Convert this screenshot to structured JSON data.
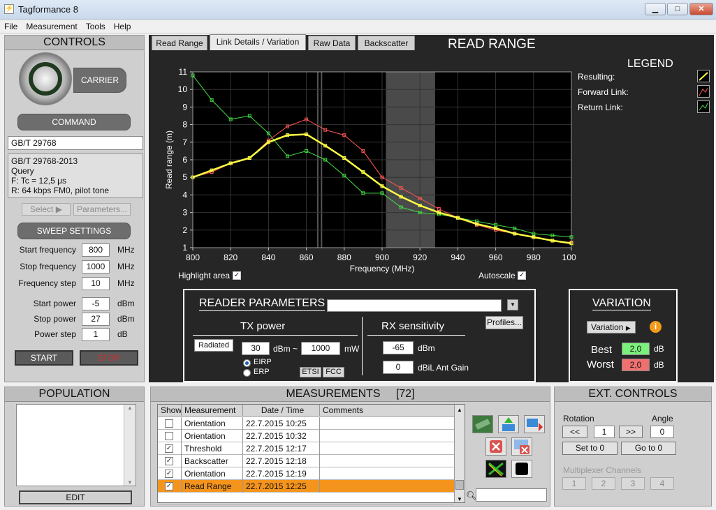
{
  "app": {
    "title": "Tagformance 8",
    "win_min": "▁",
    "win_max": "□",
    "win_close": "✕"
  },
  "menu": [
    "File",
    "Measurement",
    "Tools",
    "Help"
  ],
  "controls": {
    "title": "CONTROLS",
    "carrier": "CARRIER",
    "command": "COMMAND",
    "command_value": "GB/T 29768",
    "info": [
      "GB/T 29768-2013",
      "Query",
      "F: Tc = 12,5 μs",
      "R: 64 kbps FM0, pilot tone"
    ],
    "select": "Select",
    "parameters": "Parameters...",
    "sweep": "SWEEP SETTINGS",
    "rows": [
      {
        "label": "Start frequency",
        "value": "800",
        "unit": "MHz"
      },
      {
        "label": "Stop frequency",
        "value": "1000",
        "unit": "MHz"
      },
      {
        "label": "Frequency step",
        "value": "10",
        "unit": "MHz"
      },
      {
        "label": "Start power",
        "value": "-5",
        "unit": "dBm"
      },
      {
        "label": "Stop power",
        "value": "27",
        "unit": "dBm"
      },
      {
        "label": "Power step",
        "value": "1",
        "unit": "dB"
      }
    ],
    "start": "START",
    "stop": "STOP"
  },
  "tabs": [
    "Read Range",
    "Link Details / Variation",
    "Raw Data",
    "Backscatter"
  ],
  "view_title": "READ RANGE",
  "legend": {
    "title": "LEGEND",
    "items": [
      "Resulting:",
      "Forward Link:",
      "Return Link:"
    ],
    "colors": [
      "#ffff44",
      "#ff5555",
      "#44dd44"
    ]
  },
  "chart_data": {
    "type": "line",
    "xlabel": "Frequency (MHz)",
    "ylabel": "Read range (m)",
    "xlim": [
      800,
      1000
    ],
    "ylim": [
      1,
      11
    ],
    "xticks": [
      800,
      820,
      840,
      860,
      880,
      900,
      920,
      940,
      960,
      980,
      1000
    ],
    "yticks": [
      1,
      2,
      3,
      4,
      5,
      6,
      7,
      8,
      9,
      10,
      11
    ],
    "highlight": [
      902,
      928
    ],
    "marker_lines": [
      866,
      868
    ],
    "series": [
      {
        "name": "Resulting",
        "color": "#ffff44",
        "x": [
          800,
          810,
          820,
          830,
          840,
          850,
          860,
          870,
          880,
          890,
          900,
          910,
          920,
          930,
          940,
          950,
          960,
          970,
          980,
          990,
          1000
        ],
        "y": [
          5.0,
          5.4,
          5.8,
          6.1,
          7.0,
          7.4,
          7.45,
          6.8,
          6.1,
          5.3,
          4.5,
          3.9,
          3.4,
          3.0,
          2.7,
          2.35,
          2.1,
          1.8,
          1.6,
          1.4,
          1.25
        ]
      },
      {
        "name": "Forward Link",
        "color": "#ff5555",
        "x": [
          800,
          810,
          820,
          830,
          840,
          850,
          860,
          870,
          880,
          890,
          900,
          910,
          920,
          930,
          940,
          950,
          960,
          970,
          980,
          990,
          1000
        ],
        "y": [
          5.0,
          5.3,
          5.8,
          6.1,
          7.1,
          7.9,
          8.3,
          7.7,
          7.4,
          6.5,
          5.0,
          4.4,
          3.8,
          3.2,
          2.7,
          2.3,
          2.0,
          1.8,
          1.6,
          1.4,
          1.3
        ]
      },
      {
        "name": "Return Link",
        "color": "#44dd44",
        "x": [
          800,
          810,
          820,
          830,
          840,
          850,
          860,
          870,
          880,
          890,
          900,
          910,
          920,
          930,
          940,
          950,
          960,
          970,
          980,
          990,
          1000
        ],
        "y": [
          10.8,
          9.4,
          8.3,
          8.5,
          7.5,
          6.2,
          6.5,
          6.0,
          5.1,
          4.1,
          4.1,
          3.3,
          3.0,
          2.9,
          2.7,
          2.5,
          2.3,
          2.1,
          1.8,
          1.7,
          1.6
        ]
      }
    ]
  },
  "highlight_area": "Highlight area",
  "autoscale": "Autoscale",
  "reader": {
    "title": "READER PARAMETERS",
    "tx": "TX power",
    "rx": "RX sensitivity",
    "profiles": "Profiles...",
    "radiated": "Radiated",
    "tx_dbm": "30",
    "tx_unit": "dBm ~",
    "tx_mw": "1000",
    "mw": "mW",
    "eirp": "EIRP",
    "erp": "ERP",
    "etsi": "ETSI",
    "fcc": "FCC",
    "rx_dbm": "-65",
    "rx_unit": "dBm",
    "ant_gain": "0",
    "ant_unit": "dBiL Ant Gain"
  },
  "variation": {
    "title": "VARIATION",
    "button": "Variation",
    "best": "Best",
    "worst": "Worst",
    "best_val": "2,0",
    "worst_val": "2,0",
    "unit": "dB"
  },
  "population": {
    "title": "POPULATION",
    "edit": "EDIT"
  },
  "measurements": {
    "title": "MEASUREMENTS",
    "count": "[72]",
    "columns": [
      "Show",
      "Measurement",
      "Date / Time",
      "Comments"
    ],
    "rows": [
      {
        "checked": false,
        "name": "Orientation",
        "time": "22.7.2015 10:25",
        "selected": false
      },
      {
        "checked": false,
        "name": "Orientation",
        "time": "22.7.2015 10:32",
        "selected": false
      },
      {
        "checked": true,
        "name": "Threshold",
        "time": "22.7.2015 12:17",
        "selected": false
      },
      {
        "checked": true,
        "name": "Backscatter",
        "time": "22.7.2015 12:18",
        "selected": false
      },
      {
        "checked": true,
        "name": "Orientation",
        "time": "22.7.2015 12:19",
        "selected": false
      },
      {
        "checked": true,
        "name": "Read Range",
        "time": "22.7.2015 12:25",
        "selected": true
      }
    ]
  },
  "ext": {
    "title": "EXT. CONTROLS",
    "rotation": "Rotation",
    "angle": "Angle",
    "left": "<<",
    "rot_val": "1",
    "right": ">>",
    "angle_val": "0",
    "set0": "Set to 0",
    "go0": "Go to 0",
    "mux": "Multiplexer Channels",
    "channels": [
      "1",
      "2",
      "3",
      "4"
    ]
  }
}
